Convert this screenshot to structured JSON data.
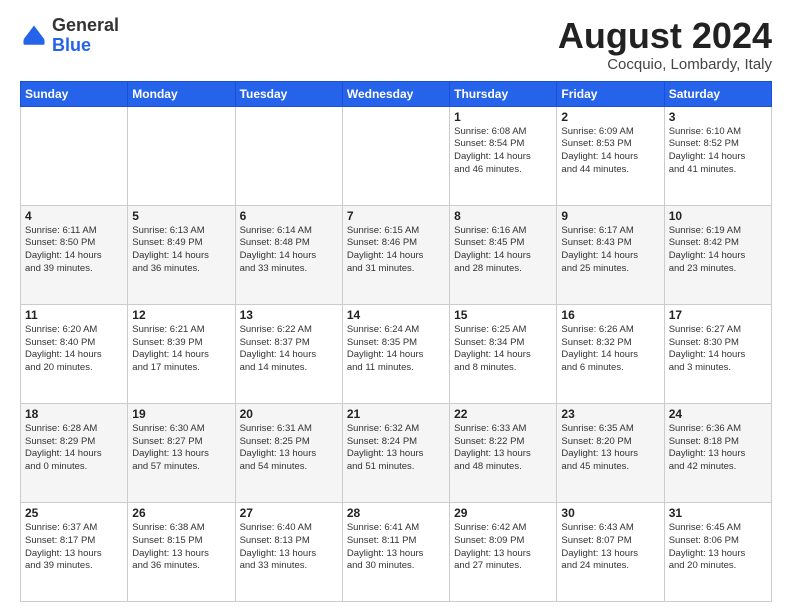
{
  "header": {
    "logo_general": "General",
    "logo_blue": "Blue",
    "month_title": "August 2024",
    "location": "Cocquio, Lombardy, Italy"
  },
  "weekdays": [
    "Sunday",
    "Monday",
    "Tuesday",
    "Wednesday",
    "Thursday",
    "Friday",
    "Saturday"
  ],
  "weeks": [
    [
      {
        "day": "",
        "info": ""
      },
      {
        "day": "",
        "info": ""
      },
      {
        "day": "",
        "info": ""
      },
      {
        "day": "",
        "info": ""
      },
      {
        "day": "1",
        "info": "Sunrise: 6:08 AM\nSunset: 8:54 PM\nDaylight: 14 hours\nand 46 minutes."
      },
      {
        "day": "2",
        "info": "Sunrise: 6:09 AM\nSunset: 8:53 PM\nDaylight: 14 hours\nand 44 minutes."
      },
      {
        "day": "3",
        "info": "Sunrise: 6:10 AM\nSunset: 8:52 PM\nDaylight: 14 hours\nand 41 minutes."
      }
    ],
    [
      {
        "day": "4",
        "info": "Sunrise: 6:11 AM\nSunset: 8:50 PM\nDaylight: 14 hours\nand 39 minutes."
      },
      {
        "day": "5",
        "info": "Sunrise: 6:13 AM\nSunset: 8:49 PM\nDaylight: 14 hours\nand 36 minutes."
      },
      {
        "day": "6",
        "info": "Sunrise: 6:14 AM\nSunset: 8:48 PM\nDaylight: 14 hours\nand 33 minutes."
      },
      {
        "day": "7",
        "info": "Sunrise: 6:15 AM\nSunset: 8:46 PM\nDaylight: 14 hours\nand 31 minutes."
      },
      {
        "day": "8",
        "info": "Sunrise: 6:16 AM\nSunset: 8:45 PM\nDaylight: 14 hours\nand 28 minutes."
      },
      {
        "day": "9",
        "info": "Sunrise: 6:17 AM\nSunset: 8:43 PM\nDaylight: 14 hours\nand 25 minutes."
      },
      {
        "day": "10",
        "info": "Sunrise: 6:19 AM\nSunset: 8:42 PM\nDaylight: 14 hours\nand 23 minutes."
      }
    ],
    [
      {
        "day": "11",
        "info": "Sunrise: 6:20 AM\nSunset: 8:40 PM\nDaylight: 14 hours\nand 20 minutes."
      },
      {
        "day": "12",
        "info": "Sunrise: 6:21 AM\nSunset: 8:39 PM\nDaylight: 14 hours\nand 17 minutes."
      },
      {
        "day": "13",
        "info": "Sunrise: 6:22 AM\nSunset: 8:37 PM\nDaylight: 14 hours\nand 14 minutes."
      },
      {
        "day": "14",
        "info": "Sunrise: 6:24 AM\nSunset: 8:35 PM\nDaylight: 14 hours\nand 11 minutes."
      },
      {
        "day": "15",
        "info": "Sunrise: 6:25 AM\nSunset: 8:34 PM\nDaylight: 14 hours\nand 8 minutes."
      },
      {
        "day": "16",
        "info": "Sunrise: 6:26 AM\nSunset: 8:32 PM\nDaylight: 14 hours\nand 6 minutes."
      },
      {
        "day": "17",
        "info": "Sunrise: 6:27 AM\nSunset: 8:30 PM\nDaylight: 14 hours\nand 3 minutes."
      }
    ],
    [
      {
        "day": "18",
        "info": "Sunrise: 6:28 AM\nSunset: 8:29 PM\nDaylight: 14 hours\nand 0 minutes."
      },
      {
        "day": "19",
        "info": "Sunrise: 6:30 AM\nSunset: 8:27 PM\nDaylight: 13 hours\nand 57 minutes."
      },
      {
        "day": "20",
        "info": "Sunrise: 6:31 AM\nSunset: 8:25 PM\nDaylight: 13 hours\nand 54 minutes."
      },
      {
        "day": "21",
        "info": "Sunrise: 6:32 AM\nSunset: 8:24 PM\nDaylight: 13 hours\nand 51 minutes."
      },
      {
        "day": "22",
        "info": "Sunrise: 6:33 AM\nSunset: 8:22 PM\nDaylight: 13 hours\nand 48 minutes."
      },
      {
        "day": "23",
        "info": "Sunrise: 6:35 AM\nSunset: 8:20 PM\nDaylight: 13 hours\nand 45 minutes."
      },
      {
        "day": "24",
        "info": "Sunrise: 6:36 AM\nSunset: 8:18 PM\nDaylight: 13 hours\nand 42 minutes."
      }
    ],
    [
      {
        "day": "25",
        "info": "Sunrise: 6:37 AM\nSunset: 8:17 PM\nDaylight: 13 hours\nand 39 minutes."
      },
      {
        "day": "26",
        "info": "Sunrise: 6:38 AM\nSunset: 8:15 PM\nDaylight: 13 hours\nand 36 minutes."
      },
      {
        "day": "27",
        "info": "Sunrise: 6:40 AM\nSunset: 8:13 PM\nDaylight: 13 hours\nand 33 minutes."
      },
      {
        "day": "28",
        "info": "Sunrise: 6:41 AM\nSunset: 8:11 PM\nDaylight: 13 hours\nand 30 minutes."
      },
      {
        "day": "29",
        "info": "Sunrise: 6:42 AM\nSunset: 8:09 PM\nDaylight: 13 hours\nand 27 minutes."
      },
      {
        "day": "30",
        "info": "Sunrise: 6:43 AM\nSunset: 8:07 PM\nDaylight: 13 hours\nand 24 minutes."
      },
      {
        "day": "31",
        "info": "Sunrise: 6:45 AM\nSunset: 8:06 PM\nDaylight: 13 hours\nand 20 minutes."
      }
    ]
  ]
}
